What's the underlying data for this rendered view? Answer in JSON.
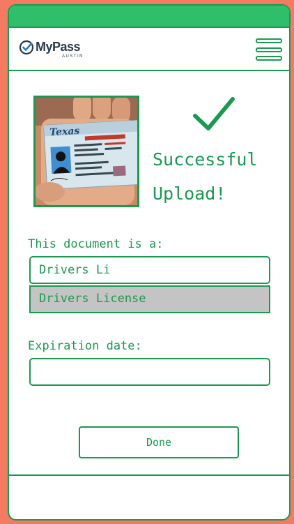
{
  "app": {
    "logo_text": "MyPass",
    "logo_subtext": "AUSTIN"
  },
  "header": {
    "menu_icon": "hamburger-menu-icon"
  },
  "upload": {
    "status_icon": "checkmark-icon",
    "status_line1": "Successful",
    "status_line2": "Upload!"
  },
  "form": {
    "document_type_label": "This document is a:",
    "document_type_value": "Drivers Li",
    "document_type_suggestion": "Drivers License",
    "expiration_label": "Expiration date:",
    "expiration_value": ""
  },
  "actions": {
    "done_label": "Done"
  },
  "colors": {
    "accent": "#1a9a50",
    "status_bar": "#2fbf6a",
    "background": "#f47a62",
    "suggestion_bg": "#c4c4c4"
  }
}
